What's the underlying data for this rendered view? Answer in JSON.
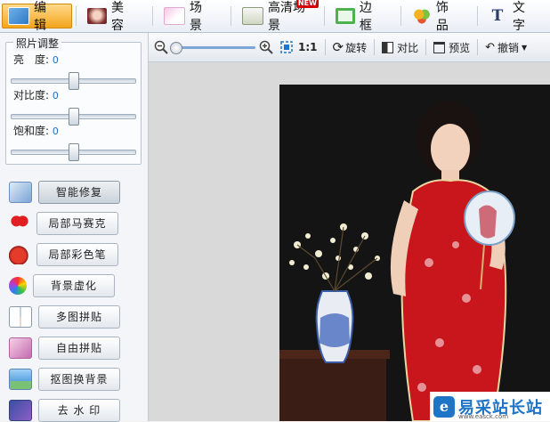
{
  "tabs": [
    {
      "label": "编 辑",
      "icon": "edit-icon",
      "active": true
    },
    {
      "label": "美 容",
      "icon": "beauty-face-icon",
      "active": false
    },
    {
      "label": "场 景",
      "icon": "scene-icon",
      "active": false
    },
    {
      "label": "高清场景",
      "icon": "hd-scene-icon",
      "active": false,
      "badge": "NEW"
    },
    {
      "label": "边 框",
      "icon": "frame-icon",
      "active": false
    },
    {
      "label": "饰 品",
      "icon": "accessory-clover-icon",
      "active": false
    },
    {
      "label": "文 字",
      "icon": "text-icon",
      "active": false
    }
  ],
  "adjust": {
    "title": "照片调整",
    "sliders": [
      {
        "label": "亮　度:",
        "value": "0",
        "level": 0.5
      },
      {
        "label": "对比度:",
        "value": "0",
        "level": 0.5
      },
      {
        "label": "饱和度:",
        "value": "0",
        "level": 0.5
      }
    ]
  },
  "tools": [
    {
      "label": "智能修复",
      "icon": "magic-wand-icon",
      "active": true
    },
    {
      "label": "局部马赛克",
      "icon": "mosaic-heart-icon",
      "active": false
    },
    {
      "label": "局部彩色笔",
      "icon": "color-apple-icon",
      "active": false
    },
    {
      "label": "背景虚化",
      "icon": "blur-dots-icon",
      "active": false
    },
    {
      "label": "多图拼贴",
      "icon": "multi-collage-icon",
      "active": false
    },
    {
      "label": "自由拼贴",
      "icon": "free-collage-icon",
      "active": false
    },
    {
      "label": "抠图换背景",
      "icon": "cutout-icon",
      "active": false
    },
    {
      "label": "去 水 印",
      "icon": "remove-watermark-icon",
      "active": false
    }
  ],
  "toolbar": {
    "zoom_level": 0.0,
    "actual_size": "1:1",
    "rotate": "旋转",
    "compare": "对比",
    "preview": "预览",
    "undo": "撤销"
  },
  "watermark": {
    "name": "易采站长站",
    "mark": "e",
    "url": "www.easck.com"
  },
  "colors": {
    "active_tab": "#f4a51c",
    "accent": "#1e74c6",
    "value_text": "#2a6acb"
  }
}
